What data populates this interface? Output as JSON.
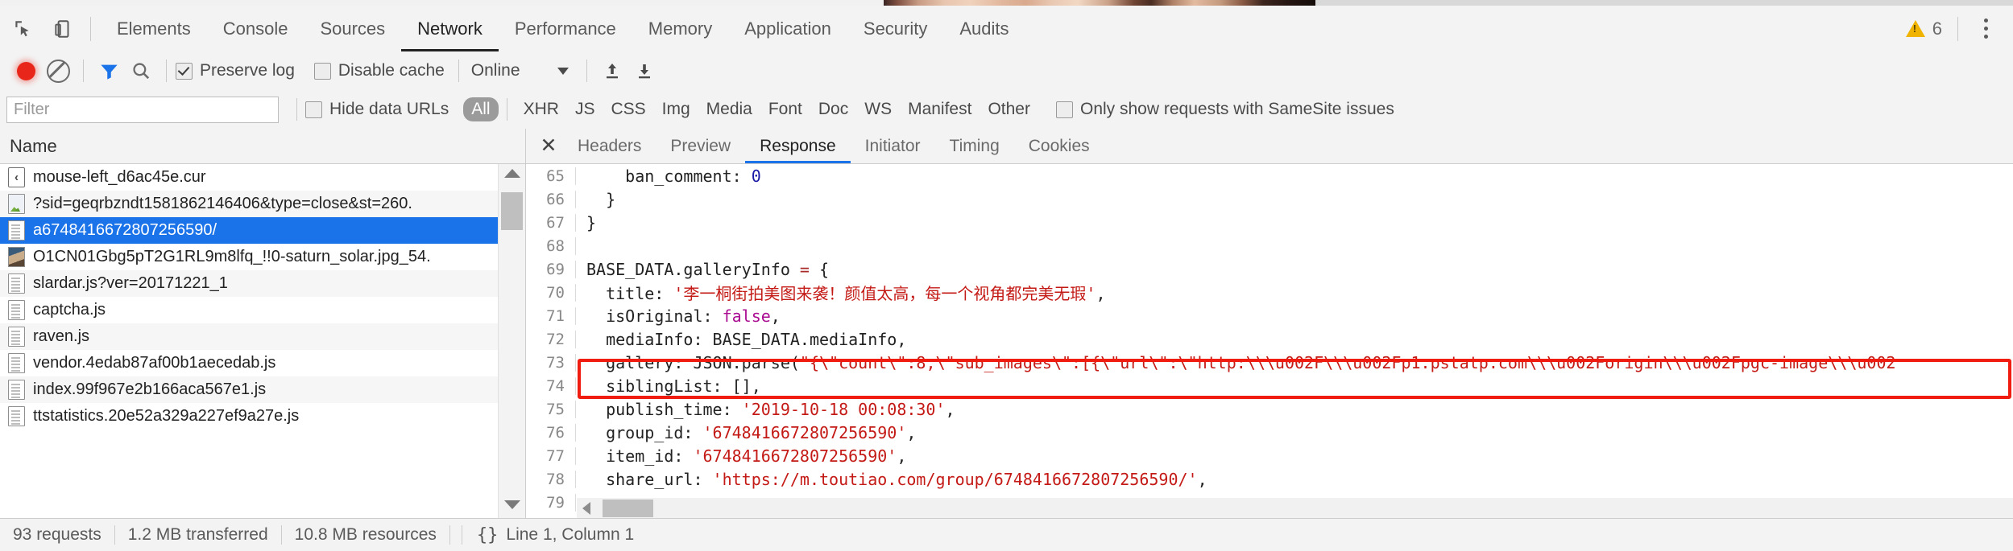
{
  "window": {
    "photo_strip_alt": "partial-page-screenshot-strip"
  },
  "main_tabs": {
    "inspect_icon": "inspect-element-icon",
    "device_icon": "device-toolbar-icon",
    "items": [
      {
        "label": "Elements",
        "active": false
      },
      {
        "label": "Console",
        "active": false
      },
      {
        "label": "Sources",
        "active": false
      },
      {
        "label": "Network",
        "active": true
      },
      {
        "label": "Performance",
        "active": false
      },
      {
        "label": "Memory",
        "active": false
      },
      {
        "label": "Application",
        "active": false
      },
      {
        "label": "Security",
        "active": false
      },
      {
        "label": "Audits",
        "active": false
      }
    ],
    "warning_icon": "warning-triangle-icon",
    "warning_count": "6",
    "menu_icon": "kebab-menu-icon"
  },
  "network_toolbar": {
    "record_icon": "record-button-icon",
    "clear_icon": "clear-icon",
    "filter_icon": "funnel-filter-icon",
    "search_icon": "search-icon",
    "preserve_log": {
      "label": "Preserve log",
      "checked": true
    },
    "disable_cache": {
      "label": "Disable cache",
      "checked": false
    },
    "throttling": {
      "value": "Online",
      "caret_icon": "chevron-down-icon"
    },
    "import_icon": "import-har-icon",
    "export_icon": "export-har-icon"
  },
  "filter_row": {
    "search_placeholder": "Filter",
    "search_value": "",
    "hide_data_urls": {
      "label": "Hide data URLs",
      "checked": false
    },
    "types": [
      {
        "label": "All",
        "active": true
      },
      {
        "label": "XHR",
        "active": false
      },
      {
        "label": "JS",
        "active": false
      },
      {
        "label": "CSS",
        "active": false
      },
      {
        "label": "Img",
        "active": false
      },
      {
        "label": "Media",
        "active": false
      },
      {
        "label": "Font",
        "active": false
      },
      {
        "label": "Doc",
        "active": false
      },
      {
        "label": "WS",
        "active": false
      },
      {
        "label": "Manifest",
        "active": false
      },
      {
        "label": "Other",
        "active": false
      }
    ],
    "samesite": {
      "label": "Only show requests with SameSite issues",
      "checked": false
    }
  },
  "requests_panel": {
    "column_header": "Name",
    "scroll_up_icon": "scroll-up-arrow-icon",
    "scroll_down_icon": "scroll-down-arrow-icon",
    "rows": [
      {
        "name": "mouse-left_d6ac45e.cur",
        "icon": "back-arrow-icon",
        "selected": false
      },
      {
        "name": "?sid=geqrbzndt1581862146406&type=close&st=260.",
        "icon": "image-file-icon",
        "selected": false
      },
      {
        "name": "a6748416672807256590/",
        "icon": "document-file-icon",
        "selected": true
      },
      {
        "name": "O1CN01Gbg5pT2G1RL9m8lfq_!!0-saturn_solar.jpg_54.",
        "icon": "photo-file-icon",
        "selected": false
      },
      {
        "name": "slardar.js?ver=20171221_1",
        "icon": "script-file-icon",
        "selected": false
      },
      {
        "name": "captcha.js",
        "icon": "script-file-icon",
        "selected": false
      },
      {
        "name": "raven.js",
        "icon": "script-file-icon",
        "selected": false
      },
      {
        "name": "vendor.4edab87af00b1aecedab.js",
        "icon": "script-file-icon",
        "selected": false
      },
      {
        "name": "index.99f967e2b166aca567e1.js",
        "icon": "script-file-icon",
        "selected": false
      },
      {
        "name": "ttstatistics.20e52a329a227ef9a27e.js",
        "icon": "script-file-icon",
        "selected": false
      }
    ]
  },
  "detail_panel": {
    "close_icon": "close-icon",
    "tabs": [
      {
        "label": "Headers",
        "active": false
      },
      {
        "label": "Preview",
        "active": false
      },
      {
        "label": "Response",
        "active": true
      },
      {
        "label": "Initiator",
        "active": false
      },
      {
        "label": "Timing",
        "active": false
      },
      {
        "label": "Cookies",
        "active": false
      }
    ],
    "code_lines": [
      {
        "n": "65",
        "segments": [
          {
            "t": "    ban_comment: ",
            "c": "plain"
          },
          {
            "t": "0",
            "c": "num"
          }
        ]
      },
      {
        "n": "66",
        "segments": [
          {
            "t": "  }",
            "c": "plain"
          }
        ]
      },
      {
        "n": "67",
        "segments": [
          {
            "t": "}",
            "c": "plain"
          }
        ]
      },
      {
        "n": "68",
        "segments": [
          {
            "t": "",
            "c": "plain"
          }
        ]
      },
      {
        "n": "69",
        "segments": [
          {
            "t": "BASE_DATA.galleryInfo ",
            "c": "plain"
          },
          {
            "t": "=",
            "c": "op"
          },
          {
            "t": " {",
            "c": "plain"
          }
        ]
      },
      {
        "n": "70",
        "segments": [
          {
            "t": "  title: ",
            "c": "plain"
          },
          {
            "t": "'李一桐街拍美图来袭！颜值太高，每一个视角都完美无瑕'",
            "c": "str"
          },
          {
            "t": ",",
            "c": "plain"
          }
        ]
      },
      {
        "n": "71",
        "segments": [
          {
            "t": "  isOriginal: ",
            "c": "plain"
          },
          {
            "t": "false",
            "c": "kw"
          },
          {
            "t": ",",
            "c": "plain"
          }
        ]
      },
      {
        "n": "72",
        "segments": [
          {
            "t": "  mediaInfo: BASE_DATA.mediaInfo,",
            "c": "plain"
          }
        ]
      },
      {
        "n": "73",
        "segments": [
          {
            "t": "  gallery: JSON.parse(",
            "c": "plain"
          },
          {
            "t": "\"{\\\"count\\\":8,\\\"sub_images\\\":[{\\\"url\\\":\\\"http:\\\\\\u002F\\\\\\u002Fp1.pstatp.com\\\\\\u002Forigin\\\\\\u002Fpgc-image\\\\\\u002",
            "c": "str"
          }
        ]
      },
      {
        "n": "74",
        "segments": [
          {
            "t": "  siblingList: [],",
            "c": "plain"
          }
        ]
      },
      {
        "n": "75",
        "segments": [
          {
            "t": "  publish_time: ",
            "c": "plain"
          },
          {
            "t": "'2019-10-18 00:08:30'",
            "c": "str"
          },
          {
            "t": ",",
            "c": "plain"
          }
        ]
      },
      {
        "n": "76",
        "segments": [
          {
            "t": "  group_id: ",
            "c": "plain"
          },
          {
            "t": "'6748416672807256590'",
            "c": "str"
          },
          {
            "t": ",",
            "c": "plain"
          }
        ]
      },
      {
        "n": "77",
        "segments": [
          {
            "t": "  item_id: ",
            "c": "plain"
          },
          {
            "t": "'6748416672807256590'",
            "c": "str"
          },
          {
            "t": ",",
            "c": "plain"
          }
        ]
      },
      {
        "n": "78",
        "segments": [
          {
            "t": "  share_url: ",
            "c": "plain"
          },
          {
            "t": "'https://m.toutiao.com/group/6748416672807256590/'",
            "c": "str"
          },
          {
            "t": ",",
            "c": "plain"
          }
        ]
      },
      {
        "n": "79",
        "segments": [
          {
            "t": "",
            "c": "plain"
          }
        ]
      }
    ],
    "highlight_annotation": "red-rectangle-on-line-73",
    "hscroll_left_icon": "scroll-left-arrow-icon"
  },
  "status_bar": {
    "requests": "93 requests",
    "transferred": "1.2 MB transferred",
    "resources": "10.8 MB resources",
    "format_icon": "pretty-print-braces-icon",
    "cursor_position": "Line 1, Column 1"
  }
}
